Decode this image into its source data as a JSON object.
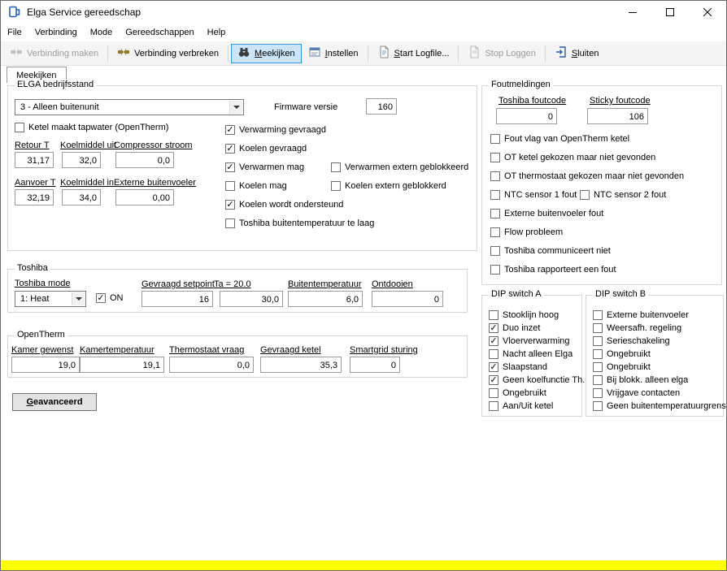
{
  "window": {
    "title": "Elga Service gereedschap"
  },
  "menu": {
    "items": [
      "File",
      "Verbinding",
      "Mode",
      "Gereedschappen",
      "Help"
    ]
  },
  "toolbar": {
    "connect": "Verbinding maken",
    "disconnect": "Verbinding verbreken",
    "watch": "Meekijken",
    "configure": "Instellen",
    "start_logfile": "Start Logfile...",
    "stop_logging": "Stop Loggen",
    "close": "Sluiten"
  },
  "tab": {
    "label": "Meekijken"
  },
  "elga": {
    "title": "ELGA bedrijfsstand",
    "mode_value": "3 - Alleen buitenunit",
    "firmware_label": "Firmware versie",
    "firmware_value": "160",
    "tapwater": {
      "label": "Ketel maakt tapwater (OpenTherm)",
      "checked": false,
      "glyph": ""
    },
    "fields": [
      {
        "label": "Retour T",
        "value": "31,17"
      },
      {
        "label": "Koelmiddel uit",
        "value": "32,0"
      },
      {
        "label": "Compressor stroom",
        "value": "0,0"
      },
      {
        "label": "Aanvoer T",
        "value": "32,19"
      },
      {
        "label": "Koelmiddel in",
        "value": "34,0"
      },
      {
        "label": "Externe buitenvoeler",
        "value": "0,00"
      }
    ],
    "status_checks": [
      {
        "label": "Verwarming gevraagd",
        "checked": true,
        "glyph": "✓"
      },
      {
        "label": "Koelen gevraagd",
        "checked": true,
        "glyph": "✓"
      },
      {
        "label": "Verwarmen mag",
        "checked": true,
        "glyph": "✓"
      },
      {
        "label": "Koelen mag",
        "checked": false,
        "glyph": ""
      },
      {
        "label": "Koelen wordt ondersteund",
        "checked": true,
        "glyph": "✓"
      },
      {
        "label": "Toshiba buitentemperatuur te laag",
        "checked": false,
        "glyph": ""
      }
    ],
    "blocked_checks": [
      {
        "label": "Verwarmen extern geblokkeerd",
        "checked": false,
        "glyph": ""
      },
      {
        "label": "Koelen extern geblokkerd",
        "checked": false,
        "glyph": ""
      }
    ]
  },
  "toshiba": {
    "title": "Toshiba",
    "mode_label": "Toshiba mode",
    "mode_value": "1: Heat",
    "on_checkbox": {
      "label": "ON",
      "checked": true,
      "glyph": "✓"
    },
    "fields": [
      {
        "label": "Gevraagd setpoint",
        "value": "16"
      },
      {
        "label": "Ta = 20.0",
        "value": "30,0"
      },
      {
        "label": "Buitentemperatuur",
        "value": "6,0"
      },
      {
        "label": "Ontdooien",
        "value": "0"
      }
    ]
  },
  "opentherm": {
    "title": "OpenTherm",
    "fields": [
      {
        "label": "Kamer gewenst",
        "value": "19,0"
      },
      {
        "label": "Kamertemperatuur",
        "value": "19,1"
      },
      {
        "label": "Thermostaat vraag",
        "value": "0,0"
      },
      {
        "label": "Gevraagd ketel",
        "value": "35,3"
      },
      {
        "label": "Smartgrid sturing",
        "value": "0"
      }
    ]
  },
  "advanced": {
    "label": "Geavanceerd"
  },
  "faults": {
    "title": "Foutmeldingen",
    "toshiba_foutcode": {
      "label": "Toshiba foutcode",
      "value": "0"
    },
    "sticky_foutcode": {
      "label": "Sticky foutcode",
      "value": "106"
    },
    "checks": [
      {
        "label": "Fout vlag van OpenTherm ketel",
        "checked": false,
        "glyph": ""
      },
      {
        "label": "OT ketel gekozen maar niet gevonden",
        "checked": false,
        "glyph": ""
      },
      {
        "label": "OT thermostaat gekozen maar niet gevonden",
        "checked": false,
        "glyph": ""
      },
      {
        "label": "NTC sensor 1 fout",
        "checked": false,
        "glyph": ""
      },
      {
        "label": "NTC sensor 2 fout",
        "checked": false,
        "glyph": ""
      },
      {
        "label": "Externe buitenvoeler fout",
        "checked": false,
        "glyph": ""
      },
      {
        "label": "Flow probleem",
        "checked": false,
        "glyph": ""
      },
      {
        "label": "Toshiba communiceert niet",
        "checked": false,
        "glyph": ""
      },
      {
        "label": "Toshiba rapporteert een fout",
        "checked": false,
        "glyph": ""
      }
    ]
  },
  "dip_a": {
    "title": "DIP switch A",
    "checks": [
      {
        "label": "Stooklijn hoog",
        "checked": false,
        "glyph": ""
      },
      {
        "label": "Duo inzet",
        "checked": true,
        "glyph": "✓"
      },
      {
        "label": "Vloerverwarming",
        "checked": true,
        "glyph": "✓"
      },
      {
        "label": "Nacht alleen Elga",
        "checked": false,
        "glyph": ""
      },
      {
        "label": "Slaapstand",
        "checked": true,
        "glyph": "✓"
      },
      {
        "label": "Geen koelfunctie Th.",
        "checked": true,
        "glyph": "✓"
      },
      {
        "label": "Ongebruikt",
        "checked": false,
        "glyph": ""
      },
      {
        "label": "Aan/Uit ketel",
        "checked": false,
        "glyph": ""
      }
    ]
  },
  "dip_b": {
    "title": "DIP switch B",
    "checks": [
      {
        "label": "Externe buitenvoeler",
        "checked": false,
        "glyph": ""
      },
      {
        "label": "Weersafh. regeling",
        "checked": false,
        "glyph": ""
      },
      {
        "label": "Serieschakeling",
        "checked": false,
        "glyph": ""
      },
      {
        "label": "Ongebruikt",
        "checked": false,
        "glyph": ""
      },
      {
        "label": "Ongebruikt",
        "checked": false,
        "glyph": ""
      },
      {
        "label": "Bij blokk. alleen elga",
        "checked": false,
        "glyph": ""
      },
      {
        "label": "Vrijgave contacten",
        "checked": false,
        "glyph": ""
      },
      {
        "label": "Geen buitentemperatuurgrens",
        "checked": false,
        "glyph": ""
      }
    ]
  }
}
